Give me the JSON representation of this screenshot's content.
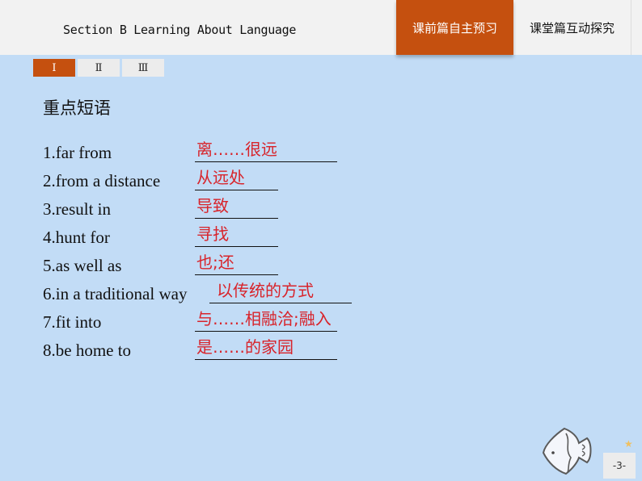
{
  "header": {
    "title": "Section B  Learning About Language",
    "tabs": [
      {
        "label": "课前篇自主预习",
        "active": true
      },
      {
        "label": "课堂篇互动探究",
        "active": false
      }
    ]
  },
  "sub_tabs": [
    {
      "label": "Ⅰ",
      "active": true
    },
    {
      "label": "Ⅱ",
      "active": false
    },
    {
      "label": "Ⅲ",
      "active": false
    }
  ],
  "section": {
    "heading": "重点短语",
    "items": [
      {
        "phrase": "1.far from",
        "answer": "离……很远"
      },
      {
        "phrase": "2.from a distance",
        "answer": "从远处"
      },
      {
        "phrase": "3.result in",
        "answer": "导致"
      },
      {
        "phrase": "4.hunt for",
        "answer": "寻找"
      },
      {
        "phrase": "5.as well as",
        "answer": "也;还"
      },
      {
        "phrase": "6.in a traditional way",
        "answer": "以传统的方式"
      },
      {
        "phrase": "7.fit into",
        "answer": "与……相融洽;融入"
      },
      {
        "phrase": "8.be home to",
        "answer": "是……的家园"
      }
    ]
  },
  "footer": {
    "page_number": "-3-",
    "decoration_icon": "fish-icon"
  },
  "colors": {
    "accent": "#c5500f",
    "background": "#c2dcf6",
    "answer": "#d8232a"
  }
}
